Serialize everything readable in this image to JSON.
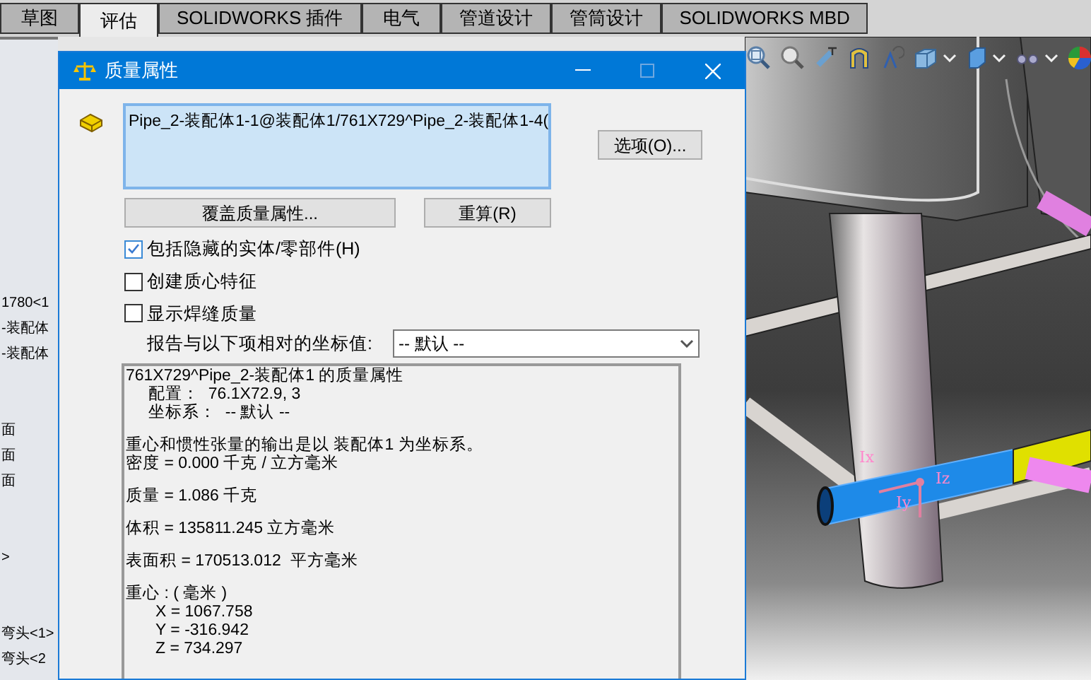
{
  "ribbon_tabs": [
    {
      "label": "草图",
      "selected": false
    },
    {
      "label": "评估",
      "selected": true
    },
    {
      "label": "SOLIDWORKS 插件",
      "selected": false
    },
    {
      "label": "电气",
      "selected": false
    },
    {
      "label": "管道设计",
      "selected": false
    },
    {
      "label": "管筒设计",
      "selected": false
    },
    {
      "label": "SOLIDWORKS MBD",
      "selected": false
    }
  ],
  "feature_tree": {
    "groups": [
      {
        "items": [
          "1780<1",
          "-装配体",
          "-装配体"
        ]
      },
      {
        "items": [
          "面",
          "面",
          "面"
        ]
      },
      {
        "items": [
          ">"
        ]
      },
      {
        "items": [
          "弯头<1>",
          "弯头<2"
        ]
      }
    ]
  },
  "viewport": {
    "axis_labels": [
      "Ix",
      "Iz",
      "Iy"
    ]
  },
  "dialog": {
    "title": "质量属性",
    "selection": "Pipe_2-装配体1-1@装配体1/761X729^Pipe_2-装配体1-4(",
    "options_button": "选项(O)...",
    "override_button": "覆盖质量属性...",
    "recalc_button": "重算(R)",
    "checkboxes": [
      {
        "label": "包括隐藏的实体/零部件(H)",
        "checked": true
      },
      {
        "label": "创建质心特征",
        "checked": false
      },
      {
        "label": "显示焊缝质量",
        "checked": false
      }
    ],
    "coordinate_label": "报告与以下项相对的坐标值:",
    "coordinate_value": "-- 默认 --",
    "results": [
      {
        "lines": [
          {
            "text": "761X729^Pipe_2-装配体1 的质量属性",
            "kind": "main"
          },
          {
            "text": "配置：  76.1X72.9, 3",
            "kind": "indent"
          },
          {
            "text": "坐标系：  -- 默认 --",
            "kind": "indent"
          }
        ]
      },
      {
        "lines": [
          {
            "text": "重心和惯性张量的输出是以 装配体1 为坐标系。",
            "kind": "main"
          },
          {
            "text": "密度 = 0.000 千克 / 立方毫米",
            "kind": "main"
          }
        ]
      },
      {
        "lines": [
          {
            "text": "质量 = 1.086 千克",
            "kind": "main"
          }
        ]
      },
      {
        "lines": [
          {
            "text": "体积 = 135811.245 立方毫米",
            "kind": "main"
          }
        ]
      },
      {
        "lines": [
          {
            "text": "表面积 = 170513.012  平方毫米",
            "kind": "main"
          }
        ]
      },
      {
        "lines": [
          {
            "text": "重心 : ( 毫米 )",
            "kind": "main"
          },
          {
            "text": "X = 1067.758",
            "kind": "deep"
          },
          {
            "text": "Y = -316.942",
            "kind": "deep"
          },
          {
            "text": "Z = 734.297",
            "kind": "deep"
          }
        ]
      }
    ]
  }
}
